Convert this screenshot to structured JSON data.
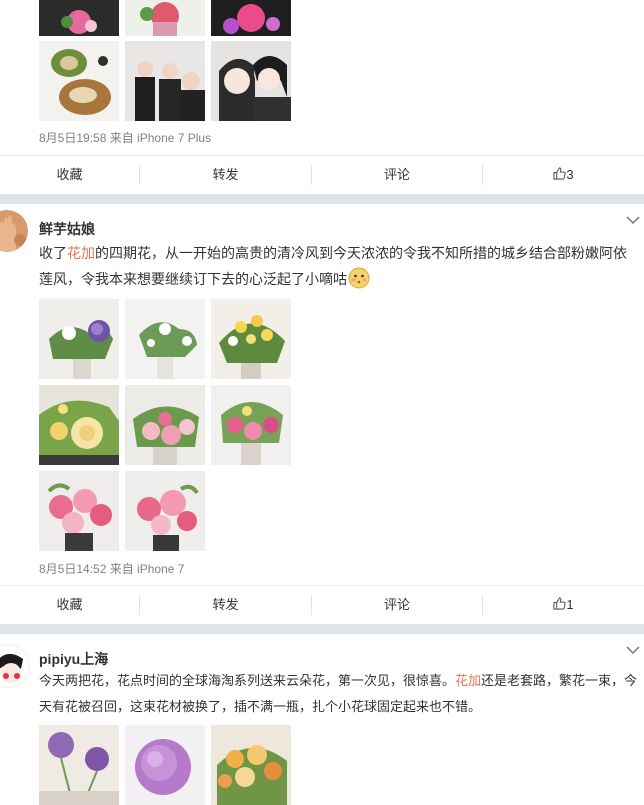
{
  "post0": {
    "meta": "8月5日19:58 来自 iPhone 7 Plus",
    "actions": {
      "fav": "收藏",
      "repost": "转发",
      "comment": "评论",
      "like_count": "3"
    }
  },
  "post1": {
    "nickname": "鲜芋姑娘",
    "text_before": "收了",
    "text_hl": "花加",
    "text_after": "的四期花，从一开始的高贵的清冷风到今天浓浓的令我不知所措的城乡结合部粉嫩阿依莲风，令我本来想要继续订下去的心泛起了小嘀咕",
    "meta": "8月5日14:52 来自 iPhone 7",
    "actions": {
      "fav": "收藏",
      "repost": "转发",
      "comment": "评论",
      "like_count": "1"
    }
  },
  "post2": {
    "nickname": "pipiyu上海",
    "text_before": "今天两把花，花点时间的全球海淘系列送来云朵花，第一次见，很惊喜。",
    "text_hl": "花加",
    "text_after": "还是老套路，繁花一束，今天有花被召回，这束花材被换了，插不满一瓶，扎个小花球固定起来也不错。"
  },
  "colors": {
    "accent_link": "#eb7350",
    "meta_gray": "#808080",
    "separator": "#dfe4ea"
  },
  "icons": {
    "like": "thumbs-up-icon",
    "more": "chevron-down-icon",
    "emoji": "blush-face-icon"
  }
}
